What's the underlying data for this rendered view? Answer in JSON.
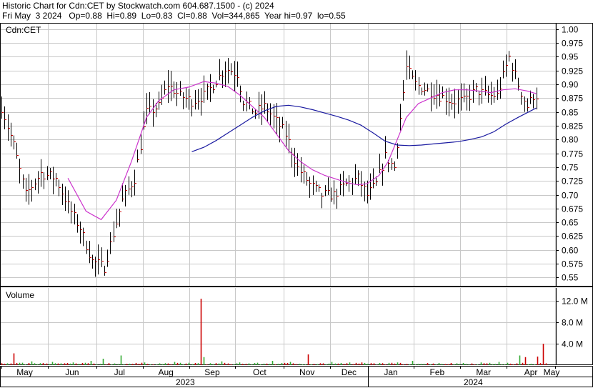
{
  "header": {
    "line1": "Historic Chart for Cdn:CET by Stockwatch.com 604.687.1500 - (c) 2024",
    "line2": "Fri May  3 2024   Op=0.88  Hi=0.89  Lo=0.83  Cl=0.88  Vol=344,865  Year hi=0.97  lo=0.55"
  },
  "colors": {
    "ma_short": "#cc33cc",
    "ma_long": "#1a1aa0",
    "price_bar": "#000000",
    "close_tick": "#cc0000",
    "volume_green": "#33aa33",
    "volume_red": "#cc0000",
    "grid": "#c8c8c8"
  },
  "chart_data": [
    {
      "type": "line",
      "panel": "price",
      "label": "Cdn:CET",
      "y_ticks": [
        "1.00",
        "0.975",
        "0.95",
        "0.925",
        "0.90",
        "0.875",
        "0.85",
        "0.825",
        "0.80",
        "0.775",
        "0.75",
        "0.725",
        "0.70",
        "0.675",
        "0.65",
        "0.625",
        "0.60",
        "0.575",
        "0.55"
      ],
      "ylim": [
        0.535,
        1.01
      ],
      "grid": true,
      "x_months": [
        "May",
        "Jun",
        "Jul",
        "Aug",
        "Sep",
        "Oct",
        "Nov",
        "Dec",
        "Jan",
        "Feb",
        "Mar",
        "Apr",
        "May"
      ],
      "x_years": [
        "2023",
        "2024"
      ],
      "price_path": [
        [
          0,
          0.86
        ],
        [
          4,
          0.79
        ],
        [
          8,
          0.7
        ],
        [
          13,
          0.74
        ],
        [
          18,
          0.73
        ],
        [
          22,
          0.68
        ],
        [
          26,
          0.64
        ],
        [
          30,
          0.58
        ],
        [
          34,
          0.57
        ],
        [
          37,
          0.63
        ],
        [
          40,
          0.69
        ],
        [
          44,
          0.73
        ],
        [
          48,
          0.85
        ],
        [
          52,
          0.86
        ],
        [
          55,
          0.9
        ],
        [
          59,
          0.88
        ],
        [
          63,
          0.87
        ],
        [
          67,
          0.88
        ],
        [
          70,
          0.9
        ],
        [
          74,
          0.93
        ],
        [
          78,
          0.92
        ],
        [
          80,
          0.87
        ],
        [
          84,
          0.85
        ],
        [
          87,
          0.86
        ],
        [
          90,
          0.84
        ],
        [
          94,
          0.81
        ],
        [
          98,
          0.75
        ],
        [
          102,
          0.72
        ],
        [
          106,
          0.7
        ],
        [
          110,
          0.7
        ],
        [
          114,
          0.72
        ],
        [
          118,
          0.73
        ],
        [
          121,
          0.7
        ],
        [
          124,
          0.72
        ],
        [
          127,
          0.77
        ],
        [
          130,
          0.75
        ],
        [
          134,
          0.93
        ],
        [
          137,
          0.9
        ],
        [
          141,
          0.89
        ],
        [
          145,
          0.88
        ],
        [
          149,
          0.87
        ],
        [
          153,
          0.87
        ],
        [
          157,
          0.89
        ],
        [
          161,
          0.88
        ],
        [
          164,
          0.88
        ],
        [
          168,
          0.95
        ],
        [
          171,
          0.9
        ],
        [
          174,
          0.86
        ],
        [
          176,
          0.88
        ],
        [
          177,
          0.88
        ]
      ],
      "series": [
        {
          "values": [
            [
              22,
              0.73
            ],
            [
              28,
              0.67
            ],
            [
              33,
              0.655
            ],
            [
              38,
              0.69
            ],
            [
              43,
              0.76
            ],
            [
              48,
              0.84
            ],
            [
              52,
              0.87
            ],
            [
              57,
              0.89
            ],
            [
              62,
              0.895
            ],
            [
              67,
              0.905
            ],
            [
              71,
              0.902
            ],
            [
              75,
              0.896
            ],
            [
              79,
              0.88
            ],
            [
              83,
              0.86
            ],
            [
              87,
              0.84
            ],
            [
              91,
              0.81
            ],
            [
              95,
              0.78
            ],
            [
              99,
              0.76
            ],
            [
              103,
              0.745
            ],
            [
              107,
              0.735
            ],
            [
              111,
              0.728
            ],
            [
              115,
              0.721
            ],
            [
              118,
              0.718
            ],
            [
              121,
              0.72
            ],
            [
              125,
              0.735
            ],
            [
              128,
              0.76
            ],
            [
              131,
              0.8
            ],
            [
              134,
              0.84
            ],
            [
              138,
              0.865
            ],
            [
              142,
              0.875
            ],
            [
              146,
              0.885
            ],
            [
              150,
              0.89
            ],
            [
              154,
              0.89
            ],
            [
              158,
              0.888
            ],
            [
              162,
              0.885
            ],
            [
              166,
              0.89
            ],
            [
              170,
              0.892
            ],
            [
              174,
              0.888
            ],
            [
              177,
              0.883
            ]
          ]
        },
        {
          "values": [
            [
              63,
              0.778
            ],
            [
              67,
              0.786
            ],
            [
              71,
              0.798
            ],
            [
              75,
              0.812
            ],
            [
              79,
              0.826
            ],
            [
              83,
              0.84
            ],
            [
              87,
              0.852
            ],
            [
              91,
              0.86
            ],
            [
              95,
              0.862
            ],
            [
              99,
              0.859
            ],
            [
              103,
              0.854
            ],
            [
              107,
              0.848
            ],
            [
              111,
              0.842
            ],
            [
              115,
              0.835
            ],
            [
              119,
              0.826
            ],
            [
              123,
              0.812
            ],
            [
              127,
              0.797
            ],
            [
              131,
              0.79
            ],
            [
              135,
              0.789
            ],
            [
              139,
              0.79
            ],
            [
              143,
              0.792
            ],
            [
              147,
              0.794
            ],
            [
              151,
              0.796
            ],
            [
              155,
              0.8
            ],
            [
              159,
              0.805
            ],
            [
              163,
              0.814
            ],
            [
              167,
              0.828
            ],
            [
              171,
              0.84
            ],
            [
              177,
              0.857
            ]
          ]
        }
      ]
    },
    {
      "type": "bar",
      "panel": "volume",
      "label": "Volume",
      "y_ticks": [
        "12.0 M",
        "8.0 M",
        "4.0 M"
      ],
      "ylim": [
        0,
        14.4
      ],
      "grid": true,
      "spikes": [
        [
          4,
          2.2,
          "red"
        ],
        [
          10,
          0.7,
          "green"
        ],
        [
          17,
          0.6,
          "green"
        ],
        [
          24,
          0.5,
          "green"
        ],
        [
          30,
          0.8,
          "green"
        ],
        [
          34,
          1.2,
          "green"
        ],
        [
          40,
          1.8,
          "green"
        ],
        [
          48,
          0.5,
          "green"
        ],
        [
          58,
          0.6,
          "green"
        ],
        [
          62,
          0.3,
          "red"
        ],
        [
          67,
          12.4,
          "red"
        ],
        [
          68,
          1.5,
          "green"
        ],
        [
          74,
          0.7,
          "green"
        ],
        [
          80,
          0.5,
          "green"
        ],
        [
          91,
          0.8,
          "green"
        ],
        [
          97,
          0.6,
          "green"
        ],
        [
          103,
          2.0,
          "red"
        ],
        [
          111,
          0.6,
          "green"
        ],
        [
          117,
          0.5,
          "green"
        ],
        [
          121,
          0.5,
          "red"
        ],
        [
          127,
          0.4,
          "green"
        ],
        [
          133,
          0.5,
          "green"
        ],
        [
          138,
          0.8,
          "green"
        ],
        [
          147,
          0.4,
          "green"
        ],
        [
          155,
          0.4,
          "green"
        ],
        [
          161,
          0.5,
          "green"
        ],
        [
          167,
          0.6,
          "green"
        ],
        [
          174,
          1.8,
          "green"
        ],
        [
          176,
          1.5,
          "red"
        ],
        [
          180,
          1.6,
          "red"
        ],
        [
          182,
          4.0,
          "red"
        ]
      ]
    }
  ]
}
